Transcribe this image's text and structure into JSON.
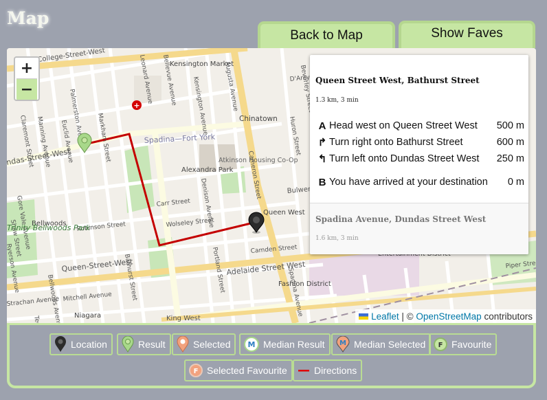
{
  "page": {
    "title": "Map"
  },
  "tabs": {
    "back_to_map": "Back to Map",
    "show_faves": "Show Faves"
  },
  "zoom": {
    "in": "+",
    "out": "−"
  },
  "directions": {
    "route1": {
      "name": "Queen Street West, Bathurst Street",
      "summary": "1.3 km, 3 min",
      "steps": [
        {
          "icon": "A",
          "text": "Head west on Queen Street West",
          "distance": "500 m"
        },
        {
          "icon": "↱",
          "text": "Turn right onto Bathurst Street",
          "distance": "600 m"
        },
        {
          "icon": "↰",
          "text": "Turn left onto Dundas Street West",
          "distance": "250 m"
        },
        {
          "icon": "B",
          "text": "You have arrived at your destination",
          "distance": "0 m"
        }
      ]
    },
    "route2": {
      "name": "Spadina Avenue, Dundas Street West",
      "summary": "1.6 km, 3 min"
    }
  },
  "map": {
    "labels": {
      "college": "College-Street-West",
      "dundas": "ndas-Street-West",
      "queen": "Queen-Street-West",
      "adelaide": "Adelaide Street West",
      "king": "King West",
      "chinatown": "Chinatown",
      "kensington": "Kensington Market",
      "spadina_fort": "Spadina—Fort York",
      "alexandra": "Alexandra Park",
      "atkinson": "Atkinson Housing Co-Op",
      "bellwoods": "Bellwoods",
      "fashion": "Fashion District",
      "entertainment": "Entertainment District",
      "niagara": "Niagara",
      "queen_west": "Queen West",
      "bulwer": "Bulwer St",
      "camden": "Camden Street",
      "carr": "Carr Street",
      "wolseley": "Wolseley Street",
      "robinson": "Robinson Street",
      "mitchell": "Mitchell Avenue",
      "piper": "Piper Street",
      "palmerston": "Palmerston Avenue",
      "markham": "Markham Street",
      "euclid": "Euclid Avenue",
      "manning": "Manning Avenue",
      "claremont": "Claremont Street",
      "bathurst": "Bathurst Street",
      "denison": "Denison Avenue",
      "augusta": "Augusta Avenue",
      "spadina": "Spadina Avenue",
      "huron": "Huron Street",
      "beverley": "Beverley Street",
      "cameron": "Cameron Street",
      "portland": "Portland Street",
      "bellevue": "Bellevue Avenue",
      "leonard": "Leonard Avenue",
      "kensington_ave": "Kensington Avenue",
      "darcy": "D'Arcy St",
      "shaw": "Shaw Street",
      "bellwoods_ave": "Bellwoods Avenue",
      "gore_vale": "Gore Vale Avenue",
      "strachan": "Strachan Avenue",
      "tecumseth": "Tecumseth St",
      "ryerson": "Ryerson Avenue",
      "trinity": "Trinity Bellwoods Park"
    },
    "attribution": {
      "leaflet": "Leaflet",
      "sep": " | © ",
      "osm": "OpenStreetMap",
      "contrib": " contributors"
    }
  },
  "legend": {
    "location": "Location",
    "result": "Result",
    "selected": "Selected",
    "median_result": "Median Result",
    "median_selected": "Median Selected",
    "favourite": "Favourite",
    "selected_favourite": "Selected Favourite",
    "directions": "Directions",
    "marker_m": "M",
    "marker_f": "F"
  },
  "colors": {
    "route": "#e00000",
    "location_marker": "#2b2b2b",
    "result_marker": "#a8d88a",
    "selected_marker": "#f2a27e",
    "median_marker": "#2f7fc2",
    "accent": "#c6e6a3"
  }
}
